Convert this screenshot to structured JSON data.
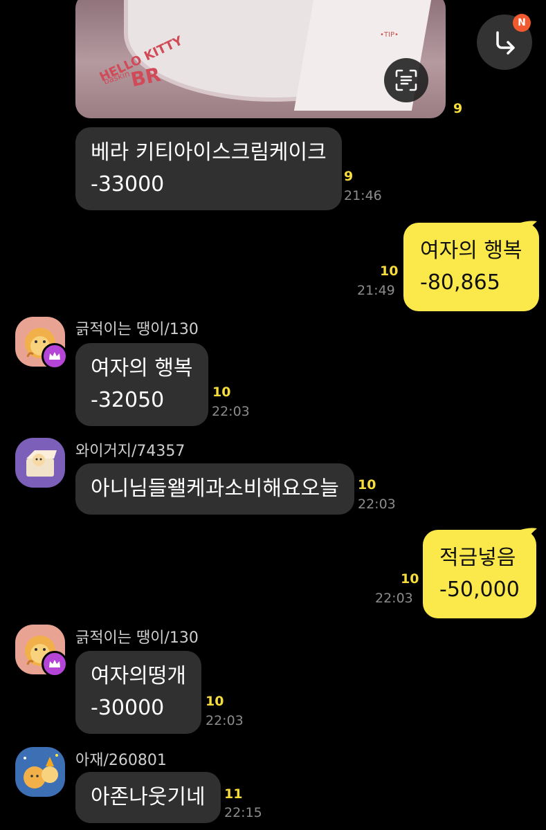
{
  "photo": {
    "brand_line1": "HELLO KITTY",
    "brand_line2": "baskin",
    "brand_line3": "BR",
    "card_label": "•TIP•",
    "unread": "9"
  },
  "header": {
    "badge": "N"
  },
  "messages": [
    {
      "lines": [
        "베라 키티아이스크림케이크",
        "-33000"
      ],
      "unread": "9",
      "time": "21:46"
    },
    {
      "lines": [
        "여자의 행복",
        "-80,865"
      ],
      "unread": "10",
      "time": "21:49"
    },
    {
      "sender": "긁적이는 땡이/130",
      "lines": [
        "여자의 행복",
        "-32050"
      ],
      "unread": "10",
      "time": "22:03"
    },
    {
      "sender": "와이거지/74357",
      "lines": [
        "아니님들왤케과소비해요오늘"
      ],
      "unread": "10",
      "time": "22:03"
    },
    {
      "lines": [
        "적금넣음",
        "-50,000"
      ],
      "unread": "10",
      "time": "22:03"
    },
    {
      "sender": "긁적이는 땡이/130",
      "lines": [
        "여자의떵개",
        "-30000"
      ],
      "unread": "10",
      "time": "22:03"
    },
    {
      "sender": "아재/260801",
      "lines": [
        "아존나웃기네"
      ],
      "unread": "11",
      "time": "22:15"
    }
  ],
  "colors": {
    "background": "#000000",
    "other_bubble": "#303030",
    "my_bubble": "#fbe84a",
    "unread": "#f6dd3b",
    "badge": "#f05a2e",
    "crown_badge": "#b545d6"
  }
}
